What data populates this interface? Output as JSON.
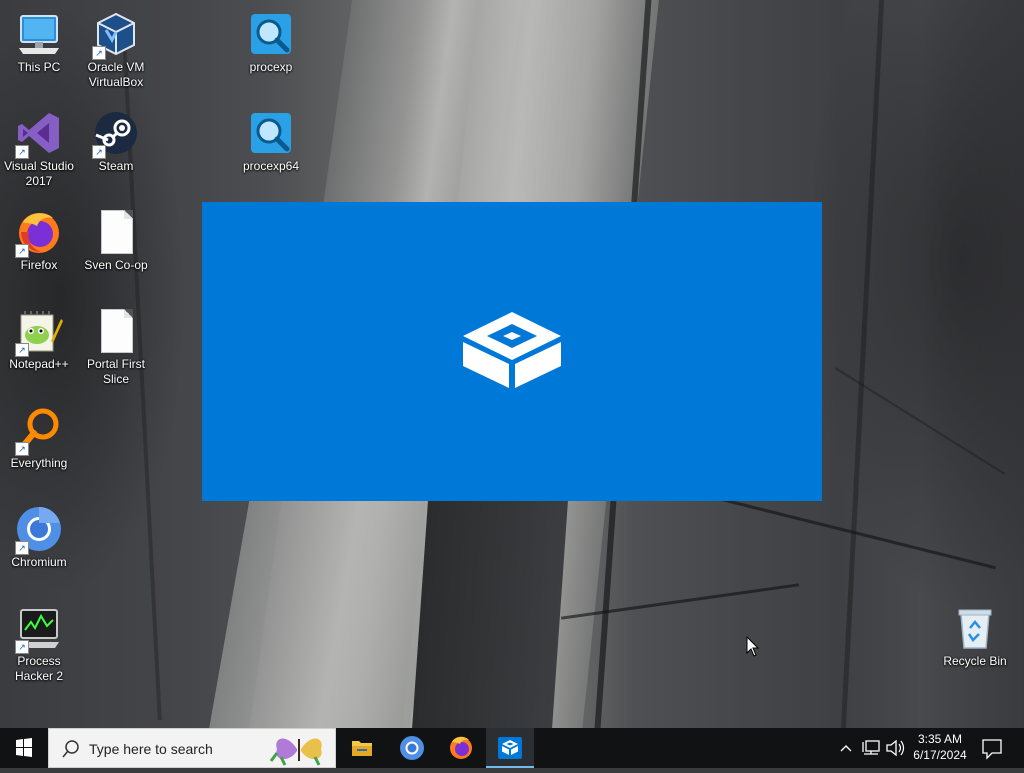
{
  "desktop": {
    "icons": [
      {
        "label": "This PC",
        "icon": "computer-icon"
      },
      {
        "label": "Oracle VM VirtualBox",
        "icon": "virtualbox-icon"
      },
      {
        "label": "procexp",
        "icon": "procexp-icon"
      },
      {
        "label": "Visual Studio 2017",
        "icon": "visual-studio-icon"
      },
      {
        "label": "Steam",
        "icon": "steam-icon"
      },
      {
        "label": "procexp64",
        "icon": "procexp-icon"
      },
      {
        "label": "Firefox",
        "icon": "firefox-icon"
      },
      {
        "label": "Sven Co-op",
        "icon": "file-icon"
      },
      {
        "label": "Notepad++",
        "icon": "notepadpp-icon"
      },
      {
        "label": "Portal First Slice",
        "icon": "file-icon"
      },
      {
        "label": "Everything",
        "icon": "everything-icon"
      },
      {
        "label": "Chromium",
        "icon": "chromium-icon"
      },
      {
        "label": "Process Hacker 2",
        "icon": "process-hacker-icon"
      },
      {
        "label": "Recycle Bin",
        "icon": "recycle-bin-icon"
      }
    ]
  },
  "splash": {
    "icon": "sandbox-icon",
    "background": "#0078d7"
  },
  "taskbar": {
    "search_placeholder": "Type here to search",
    "apps": [
      {
        "name": "File Explorer",
        "icon": "folder-icon"
      },
      {
        "name": "Chromium",
        "icon": "chromium-icon"
      },
      {
        "name": "Firefox",
        "icon": "firefox-icon"
      },
      {
        "name": "Windows Sandbox",
        "icon": "sandbox-icon",
        "active": true
      }
    ],
    "clock": {
      "time": "3:35 AM",
      "date": "6/17/2024"
    }
  },
  "colors": {
    "accent": "#0078d7",
    "taskbar": "#101214"
  }
}
